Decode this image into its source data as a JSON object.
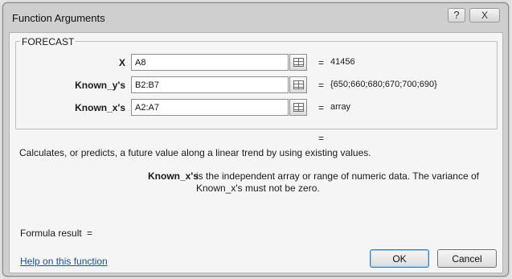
{
  "window": {
    "title": "Function Arguments",
    "help_glyph": "?",
    "close_glyph": "X"
  },
  "group": {
    "title": "FORECAST"
  },
  "arguments": [
    {
      "label": "X",
      "value": "A8",
      "eq": "=",
      "result": "41456",
      "ref_icon": "range-select-icon"
    },
    {
      "label": "Known_y's",
      "value": "B2:B7",
      "eq": "=",
      "result": "{650;660;680;670;700;690}",
      "ref_icon": "range-select-icon"
    },
    {
      "label": "Known_x's",
      "value": "A2:A7",
      "eq": "=",
      "result": "array",
      "ref_icon": "range-select-icon"
    }
  ],
  "total_eq": "=",
  "description": "Calculates, or predicts, a future value along a linear trend by using existing values.",
  "arg_help": {
    "name": "Known_x's",
    "text": "is the independent array or range of numeric data. The variance of Known_x's must not be zero."
  },
  "formula_result": {
    "label": "Formula result",
    "eq": "="
  },
  "help_link": "Help on this function",
  "buttons": {
    "ok": "OK",
    "cancel": "Cancel"
  }
}
